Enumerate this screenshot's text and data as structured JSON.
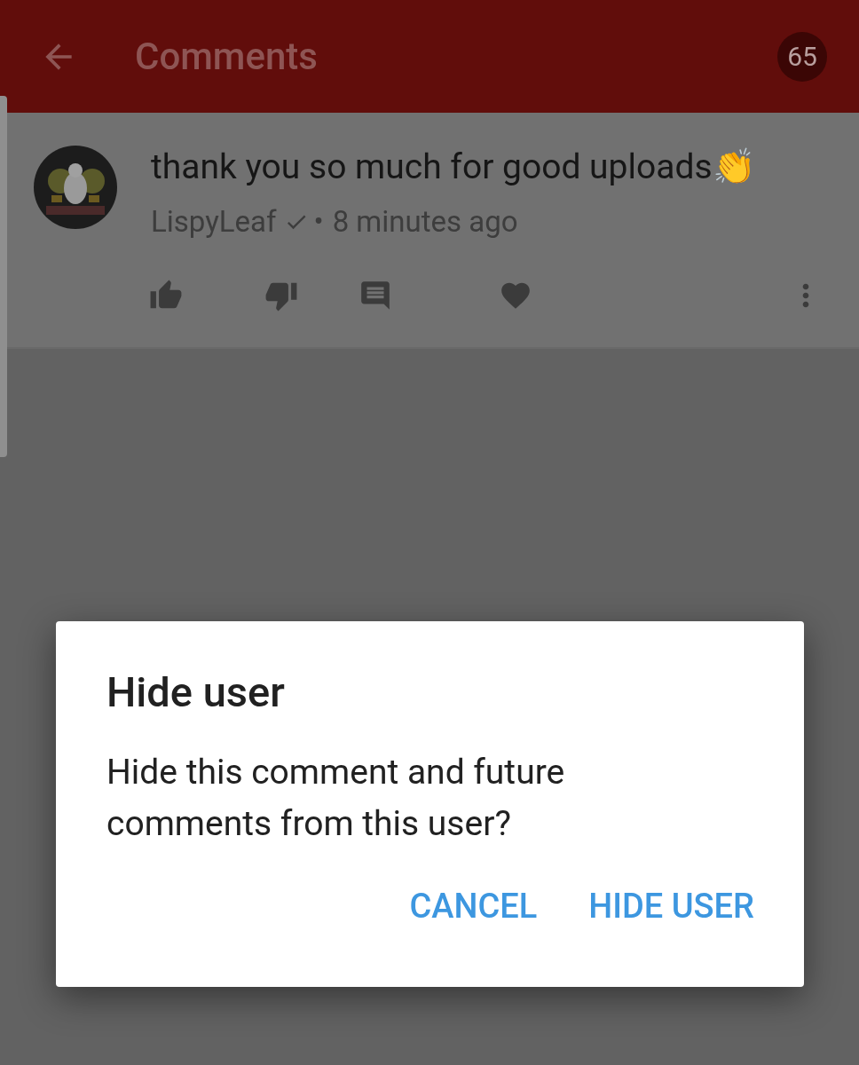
{
  "header": {
    "title": "Comments",
    "count": "65"
  },
  "comment": {
    "text": "thank you so much for good uploads👏",
    "author": "LispyLeaf",
    "verified": true,
    "separator": "•",
    "time": "8 minutes ago"
  },
  "actions": [
    {
      "kind": "like"
    },
    {
      "kind": "dislike"
    },
    {
      "kind": "reply"
    },
    {
      "kind": "heart"
    },
    {
      "kind": "more"
    }
  ],
  "dialog": {
    "title": "Hide user",
    "message": "Hide this comment and future comments from this user?",
    "buttons": [
      "CANCEL",
      "HIDE USER"
    ]
  }
}
